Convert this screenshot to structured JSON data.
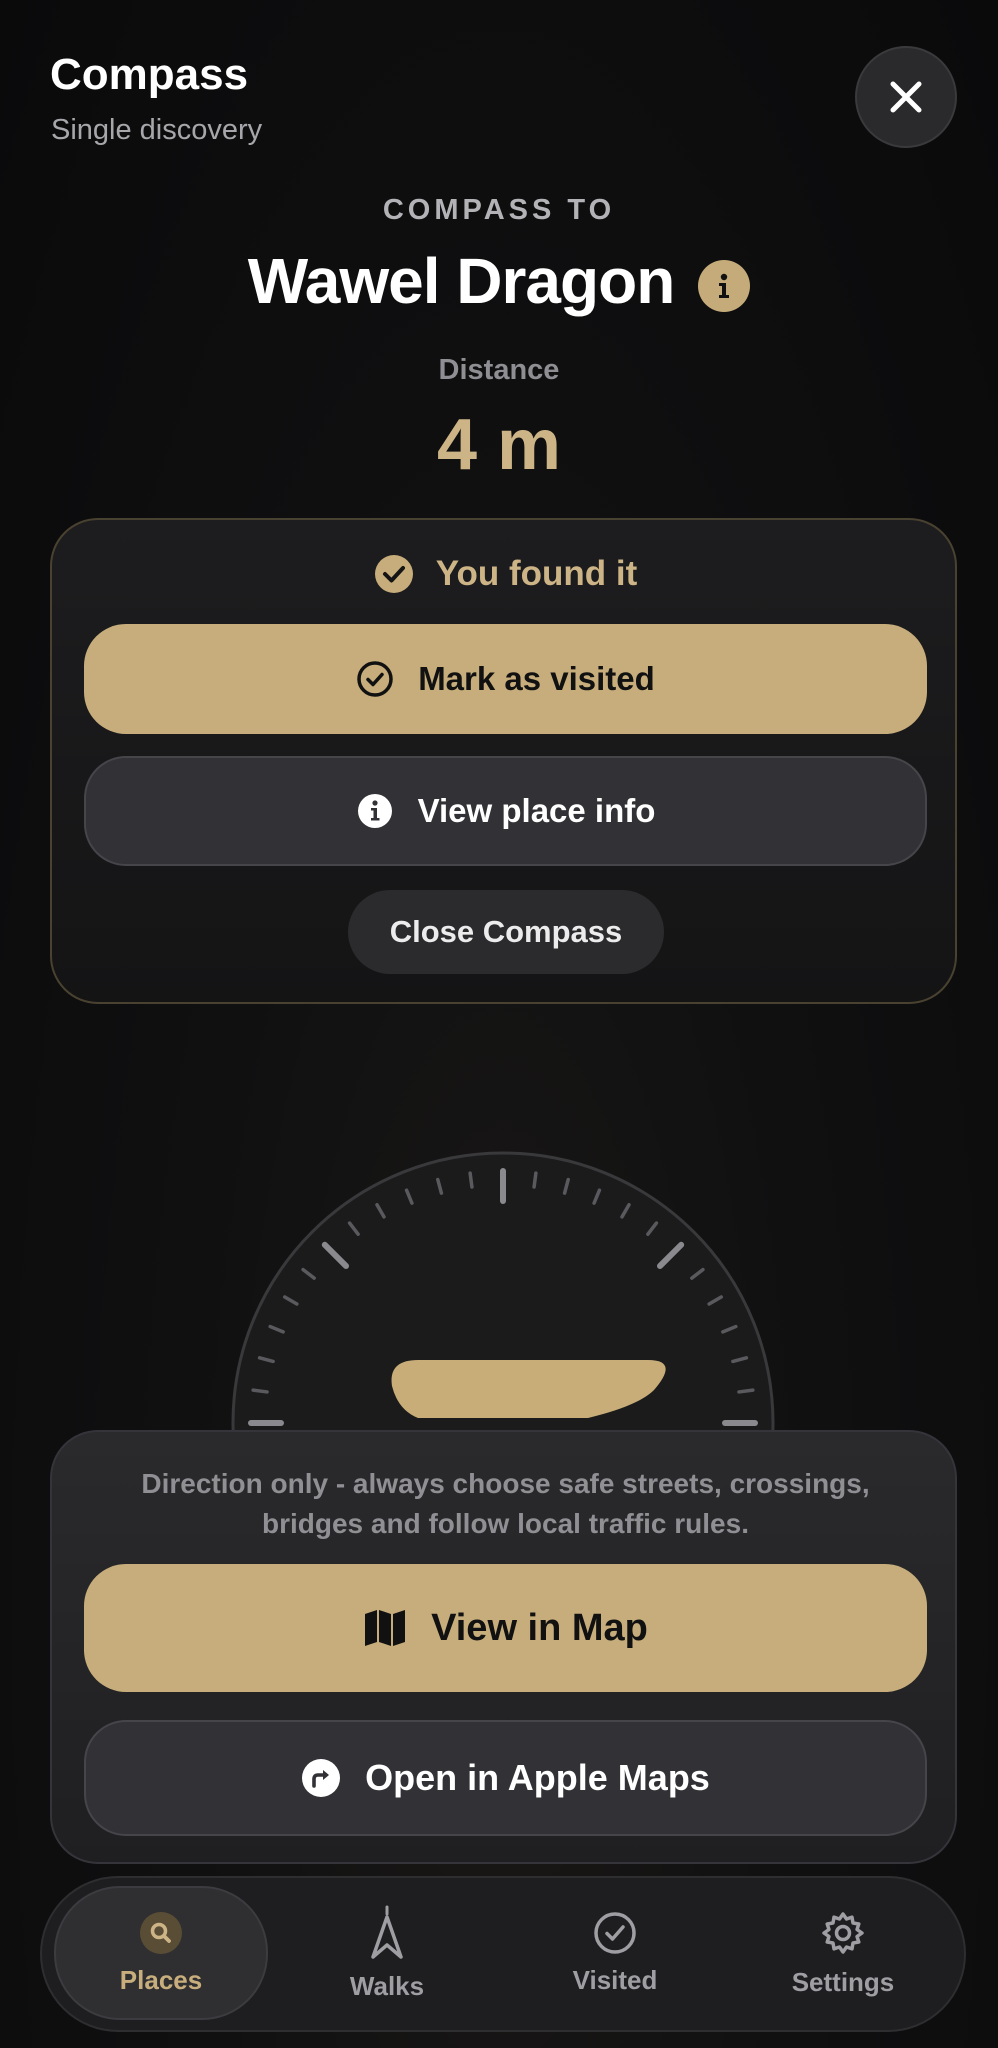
{
  "header": {
    "title": "Compass",
    "subtitle": "Single discovery"
  },
  "compass": {
    "eyebrow": "COMPASS TO",
    "place_name": "Wawel Dragon",
    "distance_label": "Distance",
    "distance_value": "4 m"
  },
  "found_card": {
    "status_text": "You found it",
    "mark_visited_label": "Mark as visited",
    "view_info_label": "View place info",
    "close_compass_label": "Close Compass"
  },
  "safety_card": {
    "warning_text": "Direction only - always choose safe streets, crossings, bridges and follow local traffic rules.",
    "view_map_label": "View in Map",
    "apple_maps_label": "Open in Apple Maps"
  },
  "tabbar": {
    "tabs": [
      {
        "label": "Places",
        "icon": "search-icon",
        "active": true
      },
      {
        "label": "Walks",
        "icon": "navigation-arrow-icon",
        "active": false
      },
      {
        "label": "Visited",
        "icon": "check-circle-icon",
        "active": false
      },
      {
        "label": "Settings",
        "icon": "gear-icon",
        "active": false
      }
    ]
  },
  "colors": {
    "accent_gold": "#c6ad7b",
    "accent_text": "#cdb486",
    "background": "#0b0b0c",
    "surface": "#1e1e20"
  }
}
